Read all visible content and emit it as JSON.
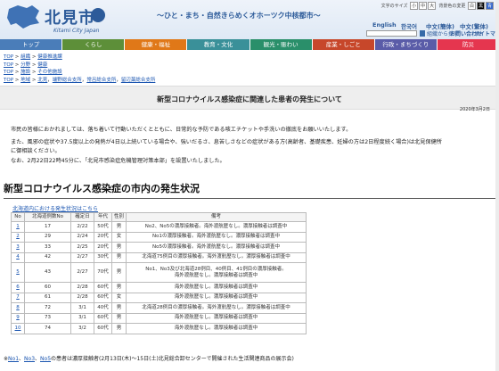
{
  "header": {
    "logo_text": "北見市",
    "logo_sub": "Kitami City Japan",
    "catchphrase": "〜ひと・まち・自然きらめくオホーツク中核都市〜",
    "font_size_label": "文字のサイズ",
    "font_sizes": [
      "小",
      "中",
      "大"
    ],
    "bg_color_label": "背景色の変更",
    "bg_colors": [
      "白",
      "黒",
      "青"
    ],
    "lang_links": [
      "English",
      "한국어",
      "中文(簡体)",
      "中文(繁体)"
    ],
    "search_btn": "検 索",
    "links": [
      "組織から探す",
      "お問い合わせ",
      "サイトマップ"
    ]
  },
  "nav": {
    "items": [
      "トップ",
      "くらし",
      "健康・福祉",
      "教育・文化",
      "観光・賑わい",
      "産業・しごと",
      "行政・まちづくり",
      "防災"
    ],
    "colors": [
      "#4a7db9",
      "#5d8f39",
      "#e07818",
      "#3a9099",
      "#2a8f6a",
      "#c7472a",
      "#5a5ca8",
      "#e5364f"
    ]
  },
  "breadcrumbs": [
    {
      "top": "TOP",
      "rest": [
        {
          "sep": " > ",
          "text": "組織"
        },
        {
          "sep": " > ",
          "text": "健康推進課"
        }
      ]
    },
    {
      "top": "TOP",
      "rest": [
        {
          "sep": " > ",
          "text": "分野"
        },
        {
          "sep": " > ",
          "text": "健康"
        }
      ]
    },
    {
      "top": "TOP",
      "rest": [
        {
          "sep": " > ",
          "text": "施設"
        },
        {
          "sep": " > ",
          "text": "その他施設"
        }
      ]
    },
    {
      "top": "TOP",
      "rest": [
        {
          "sep": " > ",
          "text": "地域"
        },
        {
          "sep": " > ",
          "text": "北見"
        },
        {
          "sep": "，",
          "text": "端野総合支所"
        },
        {
          "sep": "，",
          "text": "常呂総合支所"
        },
        {
          "sep": "，",
          "text": "留辺蘂総合支所"
        }
      ]
    }
  ],
  "article": {
    "title": "新型コロナウイルス感染症に関連した患者の発生について",
    "date": "2020年3月2日",
    "paragraphs": [
      "市民の皆様におかれましては、落ち着いて行動いただくとともに、日常的な予防である咳エチケットや手洗いの徹底をお願いいたします。",
      "また、風邪の症状や37.5度以上の発熱が4日以上続いている場合や、強いだるさ、息苦しさなどの症状がある方(高齢者、基礎疾患、妊婦の方は2日程度続く場合)は北見保健所",
      "に御相談ください。",
      "なお、2月22日22時45分に、「北見市感染症危機管理対策本部」を設置いたしました。"
    ]
  },
  "section": {
    "heading": "新型コロナウイルス感染症の市内の発生状況",
    "link": "北海道内における発生状況はこちら"
  },
  "table": {
    "headers": [
      "No",
      "北海道例数No",
      "確定日",
      "年代",
      "性別",
      "備考"
    ],
    "rows": [
      {
        "no": "1",
        "case": "17",
        "date": "2/22",
        "age": "50代",
        "sex": "男",
        "note": [
          "No2、No5の濃厚接触者。海外渡航歴なし。濃厚接触者は調査中"
        ]
      },
      {
        "no": "2",
        "case": "29",
        "date": "2/24",
        "age": "20代",
        "sex": "女",
        "note": [
          "No1の濃厚接触者。海外渡航歴なし。濃厚接触者は調査中"
        ]
      },
      {
        "no": "3",
        "case": "33",
        "date": "2/25",
        "age": "20代",
        "sex": "男",
        "note": [
          "No5の濃厚接触者。海外渡航歴なし。濃厚接触者は調査中"
        ]
      },
      {
        "no": "4",
        "case": "42",
        "date": "2/27",
        "age": "30代",
        "sex": "男",
        "note": [
          "北海道75例目の濃厚接触者。海外渡航歴なし。濃厚接触者は調査中"
        ]
      },
      {
        "no": "5",
        "case": "43",
        "date": "2/27",
        "age": "70代",
        "sex": "男",
        "note": [
          "No1、No3及び北海道28例目、40例目、41例目の濃厚接触者。",
          "海外渡航歴なし。濃厚接触者は調査中"
        ]
      },
      {
        "no": "6",
        "case": "60",
        "date": "2/28",
        "age": "60代",
        "sex": "男",
        "note": [
          "海外渡航歴なし。濃厚接触者は調査中"
        ]
      },
      {
        "no": "7",
        "case": "61",
        "date": "2/28",
        "age": "60代",
        "sex": "女",
        "note": [
          "海外渡航歴なし。濃厚接触者は調査中"
        ]
      },
      {
        "no": "8",
        "case": "72",
        "date": "3/1",
        "age": "40代",
        "sex": "男",
        "note": [
          "北海道28例目の濃厚接触者。海外渡航歴なし。濃厚接触者は調査中"
        ]
      },
      {
        "no": "9",
        "case": "73",
        "date": "3/1",
        "age": "60代",
        "sex": "男",
        "note": [
          "海外渡航歴なし。濃厚接触者は調査中"
        ]
      },
      {
        "no": "10",
        "case": "74",
        "date": "3/2",
        "age": "60代",
        "sex": "男",
        "note": [
          "海外渡航歴なし。濃厚接触者は調査中"
        ]
      }
    ]
  },
  "footnote": {
    "mark": "※",
    "links": [
      "No1",
      "No3",
      "No5"
    ],
    "text": "の患者は濃厚接触者(2月13日(木)〜15日(土)北見総合卸センターで開催された生活関連商品の展示会)"
  }
}
